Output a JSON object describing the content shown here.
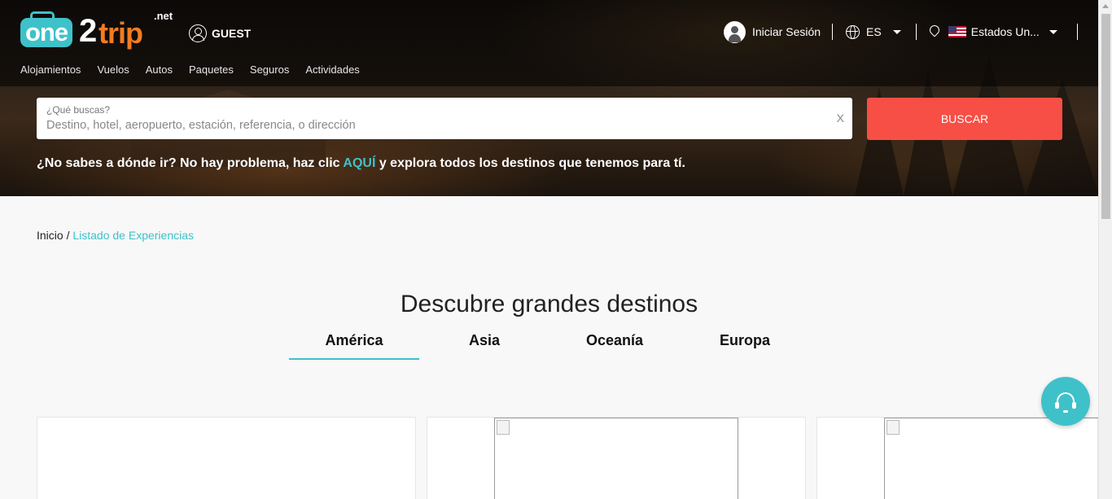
{
  "brand": {
    "one": "one",
    "two": "2",
    "trip": "trip",
    "net": ".net",
    "accent": "#3ec1c9",
    "orange": "#f47b20"
  },
  "header": {
    "guest_label": "GUEST",
    "login_label": "Iniciar Sesión",
    "language": "ES",
    "country": "Estados Un...",
    "nav": [
      "Alojamientos",
      "Vuelos",
      "Autos",
      "Paquetes",
      "Seguros",
      "Actividades"
    ]
  },
  "search": {
    "label": "¿Qué buscas?",
    "placeholder": "Destino, hotel, aeropuerto, estación, referencia, o dirección",
    "clear": "X",
    "button": "BUSCAR",
    "button_color": "#f74f45"
  },
  "promo": {
    "before": "¿No sabes a dónde ir? No hay problema, haz clic ",
    "link": "AQUÍ",
    "after": " y explora todos los destinos que tenemos para tí."
  },
  "breadcrumb": {
    "home": "Inicio",
    "separator": " / ",
    "current": "Listado de Experiencias"
  },
  "main": {
    "heading": "Descubre grandes destinos",
    "tabs": [
      "América",
      "Asia",
      "Oceanía",
      "Europa"
    ],
    "active_tab": "América"
  },
  "support_icon": "headset-icon"
}
